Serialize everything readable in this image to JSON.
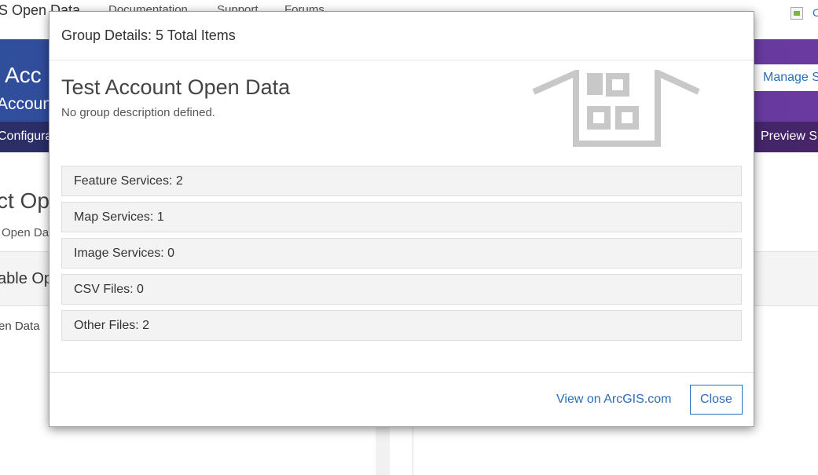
{
  "background": {
    "brand": "S Open Data",
    "nav": [
      "Documentation",
      "Support",
      "Forums"
    ],
    "top_right_link": "C",
    "banner_title": "Acc",
    "banner_subtitle": "Accoun",
    "banner_tab_left": "Configura",
    "banner_tab_right": "Preview S",
    "manage_button": "Manage S",
    "heading": "ct Op",
    "subheading": "Open Da",
    "panel_title": "able Op",
    "panel_text": "en Data"
  },
  "modal": {
    "title": "Group Details: 5 Total Items",
    "group_name": "Test Account Open Data",
    "group_description": "No group description defined.",
    "icon": "group-building-icon",
    "stats": [
      {
        "label": "Feature Services: 2"
      },
      {
        "label": "Map Services: 1"
      },
      {
        "label": "Image Services: 0"
      },
      {
        "label": "CSV Files: 0"
      },
      {
        "label": "Other Files: 2"
      }
    ],
    "view_link": "View on ArcGIS.com",
    "close_label": "Close"
  },
  "colors": {
    "link": "#2a6ebb",
    "banner_start": "#2f4f9b",
    "banner_end": "#6b3aa0",
    "icon_gray": "#c8c8c8",
    "stat_bg": "#f3f3f3"
  }
}
